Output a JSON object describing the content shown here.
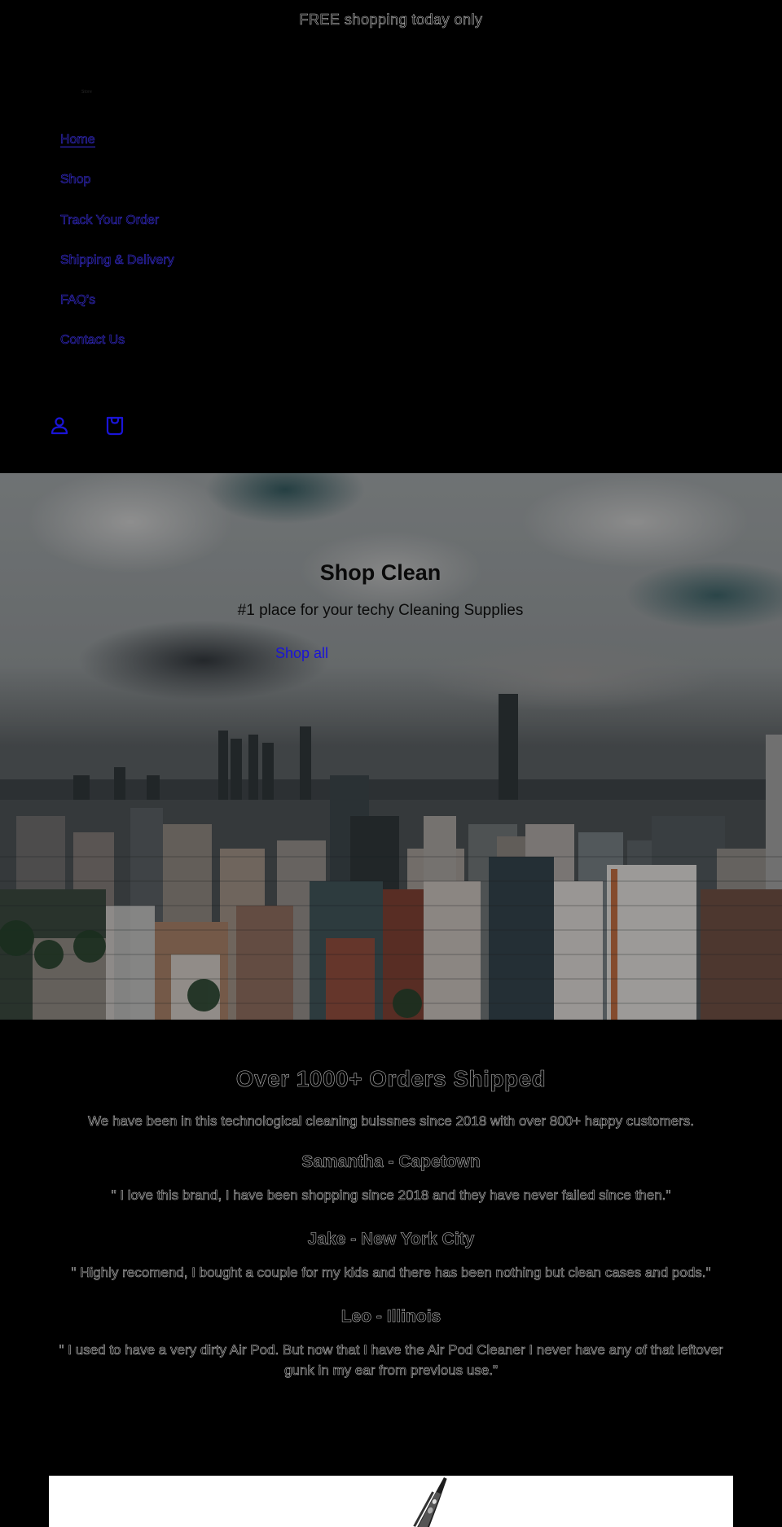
{
  "announcement": {
    "text": "FREE shopping today only"
  },
  "header": {
    "logo_text": "Store",
    "nav": [
      {
        "label": "Home",
        "active": true
      },
      {
        "label": "Shop",
        "active": false
      },
      {
        "label": "Track Your Order",
        "active": false
      },
      {
        "label": "Shipping & Delivery",
        "active": false
      },
      {
        "label": "FAQ's",
        "active": false
      },
      {
        "label": "Contact Us",
        "active": false
      }
    ],
    "icons": [
      {
        "name": "account-icon",
        "label": "Log in"
      },
      {
        "name": "cart-icon",
        "label": "Cart"
      }
    ]
  },
  "hero": {
    "title": "Shop Clean",
    "subtitle": "#1 place for your techy Cleaning Supplies",
    "button_label": "Shop all",
    "image_description": "Cloudy city skyline aerial view"
  },
  "testimonials": {
    "heading": "Over 1000+ Orders Shipped",
    "intro": "We have been in this technological cleaning buissnes since 2018 with over 800+ happy customers.",
    "items": [
      {
        "name": "Samantha - Capetown",
        "quote": "\" I love this brand, I have been shopping since 2018 and they have never failed since then.\""
      },
      {
        "name": "Jake - New York City",
        "quote": "\" Highly recomend, I bought a couple for my kids and there has been nothing but clean cases and pods.\""
      },
      {
        "name": "Leo - Illinois",
        "quote": "\" I used to have a very dirty Air Pod. But now that I have the Air Pod Cleaner I never have any of that leftover gunk in my ear from previous use.\""
      }
    ]
  },
  "product_image": {
    "description": "Air Pod cleaning pen"
  },
  "colors": {
    "background": "#000000",
    "link_blue": "#1a14d8",
    "outline_text": "#bdbdbd"
  }
}
